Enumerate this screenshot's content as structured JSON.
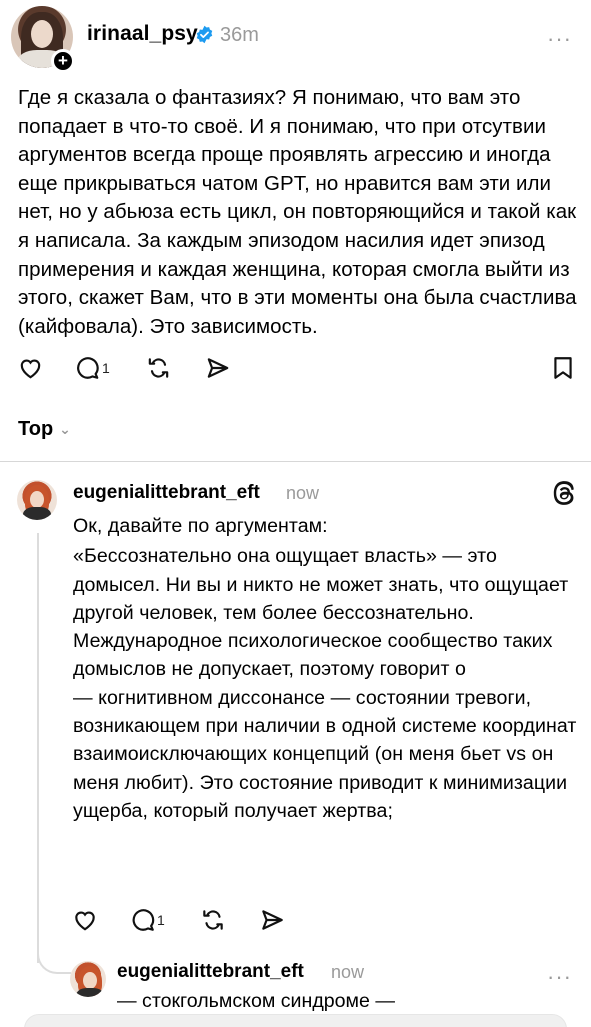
{
  "post": {
    "username": "irinaal_psy",
    "verified_icon": "verified-badge-icon",
    "time": "36m",
    "more": "···",
    "follow_symbol": "+",
    "text": "Где я сказала о фантазиях? Я понимаю, что вам это попадает в что-то своё. И я понимаю, что при отсутвии аргументов всегда проще проявлять агрессию и иногда еще прикрываться чатом GPT, но нравится вам эти или нет, но у абьюза есть цикл, он повторяющийся и такой как я написала. За каждым эпизодом насилия идет эпизод примерения и каждая женщина, которая смогла выйти из этого, скажет Вам, что в эти моменты она была счастлива (кайфовала). Это зависимость.",
    "reply_count": "1"
  },
  "sort": {
    "label": "Top",
    "chevron": "⌄"
  },
  "reply": {
    "username": "eugenialittebrant_eft",
    "time": "now",
    "paragraphs": [
      "Ок, давайте по аргументам:",
      "«Бессознательно она ощущает власть» — это домысел. Ни вы и никто не может знать, что ощущает другой человек, тем более бессознательно. Международное психологическое сообщество таких домыслов не допускает, поэтому говорит о",
      "— когнитивном диссонансе — состоянии тревоги, возникающем при наличии в одной системе координат взаимоисключающих концепций (он меня бьет vs он меня любит). Это состояние приводит к минимизации ущерба, который получает жертва;"
    ],
    "reply_count": "1"
  },
  "sub_reply": {
    "username": "eugenialittebrant_eft",
    "time": "now",
    "more": "···",
    "text": "— стокгольмском синдроме —"
  },
  "icons": {
    "like": "heart-icon",
    "comment": "comment-icon",
    "repost": "repost-icon",
    "share": "send-icon",
    "save": "bookmark-icon",
    "threads": "threads-logo-icon"
  }
}
